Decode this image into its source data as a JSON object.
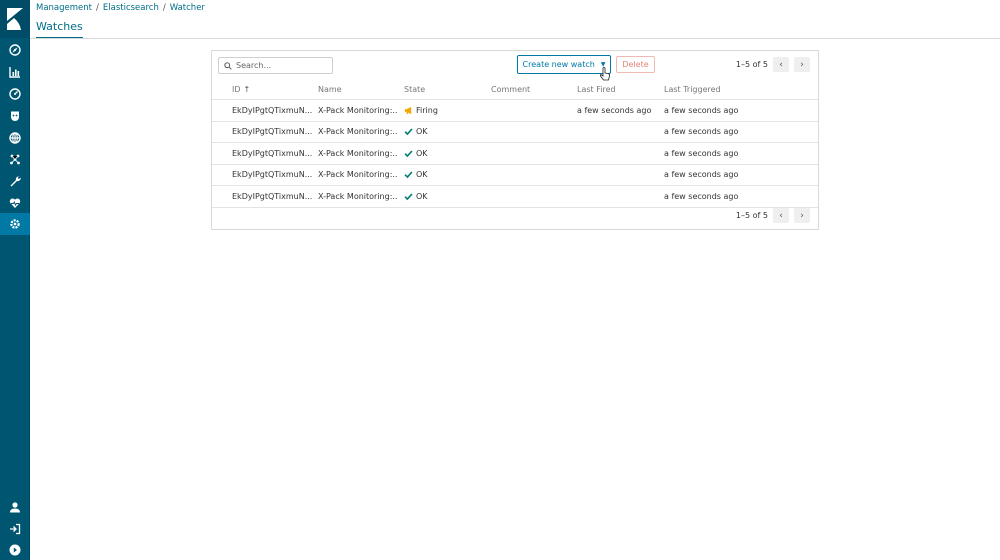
{
  "breadcrumbs": [
    "Management",
    "Elasticsearch",
    "Watcher"
  ],
  "breadcrumb_separator": "/",
  "page_title": "Watches",
  "search": {
    "placeholder": "Search...",
    "value": ""
  },
  "toolbar": {
    "create_label": "Create new watch",
    "delete_label": "Delete"
  },
  "pagination": {
    "label": "1–5 of 5"
  },
  "table": {
    "columns": {
      "id": "ID",
      "name": "Name",
      "state": "State",
      "comment": "Comment",
      "last_fired": "Last Fired",
      "last_triggered": "Last Triggered"
    },
    "rows": [
      {
        "id": "EkDyIPgtQTixmuN...",
        "name": "X-Pack Monitoring:...",
        "state": "Firing",
        "comment": "",
        "last_fired": "a few seconds ago",
        "last_triggered": "a few seconds ago"
      },
      {
        "id": "EkDyIPgtQTixmuN...",
        "name": "X-Pack Monitoring:...",
        "state": "OK",
        "comment": "",
        "last_fired": "",
        "last_triggered": "a few seconds ago"
      },
      {
        "id": "EkDyIPgtQTixmuN...",
        "name": "X-Pack Monitoring:...",
        "state": "OK",
        "comment": "",
        "last_fired": "",
        "last_triggered": "a few seconds ago"
      },
      {
        "id": "EkDyIPgtQTixmuN...",
        "name": "X-Pack Monitoring:...",
        "state": "OK",
        "comment": "",
        "last_fired": "",
        "last_triggered": "a few seconds ago"
      },
      {
        "id": "EkDyIPgtQTixmuN...",
        "name": "X-Pack Monitoring:...",
        "state": "OK",
        "comment": "",
        "last_fired": "",
        "last_triggered": "a few seconds ago"
      }
    ]
  },
  "sidebar": {
    "top_icons": [
      "discover-icon",
      "visualize-icon",
      "dashboard-icon",
      "timelion-icon",
      "apm-icon",
      "graph-icon",
      "dev-tools-icon",
      "monitoring-icon",
      "management-icon"
    ],
    "bottom_icons": [
      "user-icon",
      "logout-icon",
      "collapse-icon"
    ],
    "active": "management-icon"
  },
  "colors": {
    "sidebar": "#005571",
    "accent": "#0079a5",
    "firing": "#f5a700",
    "ok": "#017d73",
    "danger": "#e68377"
  }
}
